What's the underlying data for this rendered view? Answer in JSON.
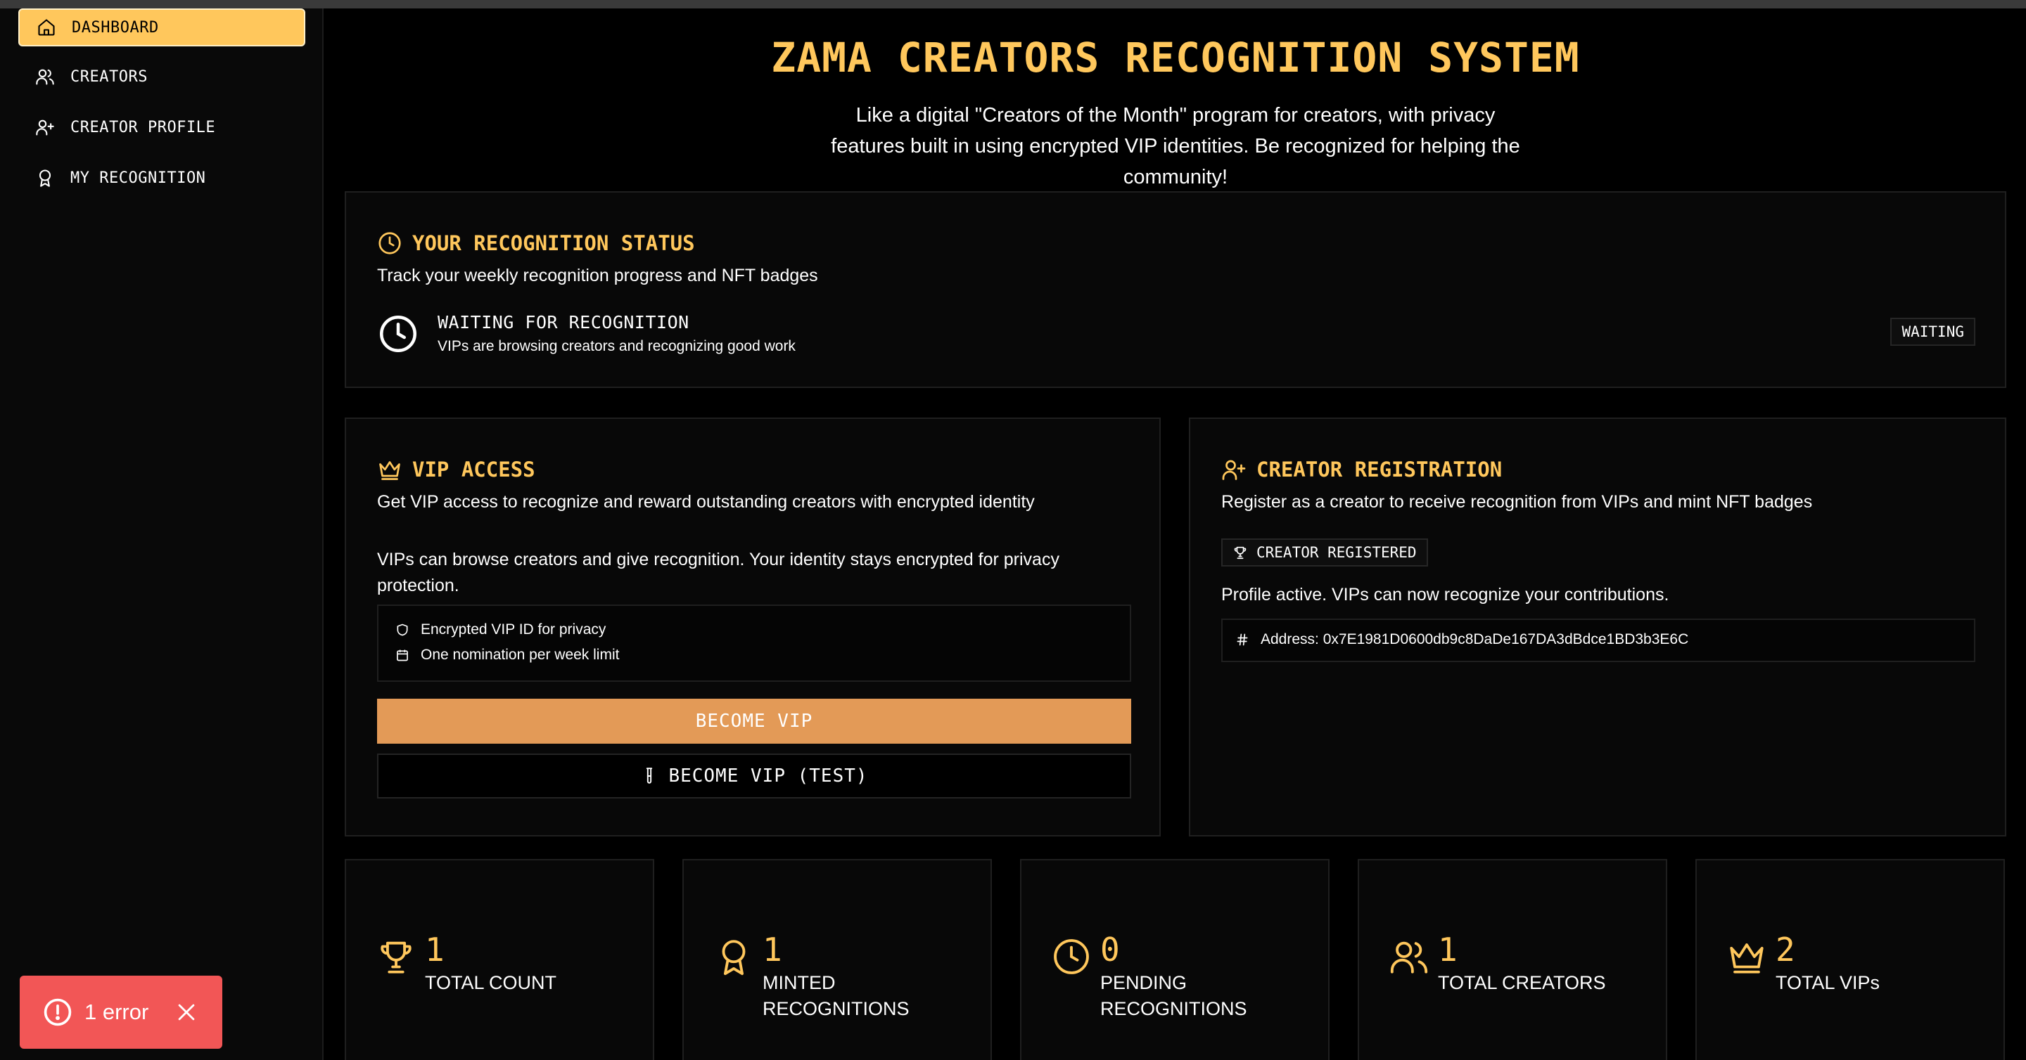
{
  "sidebar": {
    "items": [
      {
        "label": "DASHBOARD",
        "icon": "home-icon",
        "active": true
      },
      {
        "label": "CREATORS",
        "icon": "users-icon"
      },
      {
        "label": "CREATOR PROFILE",
        "icon": "user-plus-icon"
      },
      {
        "label": "MY RECOGNITION",
        "icon": "award-icon"
      }
    ]
  },
  "header": {
    "title": "ZAMA CREATORS RECOGNITION SYSTEM",
    "subtitle": "Like a digital \"Creators of the Month\" program for creators, with privacy features built in using encrypted VIP identities. Be recognized for helping the community!"
  },
  "recognition_status": {
    "title": "YOUR RECOGNITION STATUS",
    "description": "Track your weekly recognition progress and NFT badges",
    "status_title": "WAITING FOR RECOGNITION",
    "status_sub": "VIPs are browsing creators and recognizing good work",
    "badge": "WAITING"
  },
  "vip_access": {
    "title": "VIP ACCESS",
    "description": "Get VIP access to recognize and reward outstanding creators with encrypted identity",
    "body": "VIPs can browse creators and give recognition. Your identity stays encrypted for privacy protection.",
    "features": [
      "Encrypted VIP ID for privacy",
      "One nomination per week limit"
    ],
    "primary_button": "BECOME VIP",
    "test_button": "BECOME VIP (TEST)"
  },
  "creator_registration": {
    "title": "CREATOR REGISTRATION",
    "description": "Register as a creator to receive recognition from VIPs and mint NFT badges",
    "badge": "CREATOR REGISTERED",
    "body": "Profile active. VIPs can now recognize your contributions.",
    "address": "Address: 0x7E1981D0600db9c8DaDe167DA3dBdce1BD3b3E6C"
  },
  "stats": [
    {
      "value": "1",
      "label": "TOTAL COUNT",
      "icon": "trophy-icon"
    },
    {
      "value": "1",
      "label": "MINTED RECOGNITIONS",
      "icon": "award-icon"
    },
    {
      "value": "0",
      "label": "PENDING RECOGNITIONS",
      "icon": "clock-icon"
    },
    {
      "value": "1",
      "label": "TOTAL CREATORS",
      "icon": "users-icon"
    },
    {
      "value": "2",
      "label": "TOTAL VIPs",
      "icon": "crown-icon"
    }
  ],
  "toast": {
    "text": "1 error"
  },
  "colors": {
    "accent": "#ffc75c",
    "button": "#e39a57",
    "error": "#f25656",
    "background": "#000000"
  }
}
